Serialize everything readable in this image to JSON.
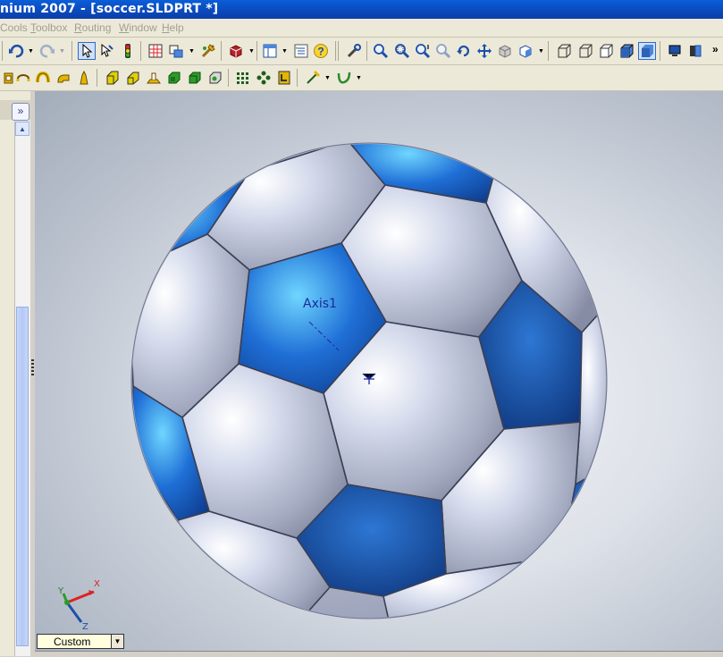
{
  "window": {
    "title": "nium 2007 - [soccer.SLDPRT *]"
  },
  "menu": {
    "items": [
      "Cools",
      "Toolbox",
      "Routing",
      "Window",
      "Help"
    ]
  },
  "toolbar_top": {
    "icons": [
      "undo-icon",
      "redo-icon",
      "select-icon",
      "smart-select-icon",
      "traffic-light-icon",
      "grid-icon",
      "options-icon",
      "rebuild-icon",
      "3d-box-icon",
      "view-layout-icon",
      "list-icon",
      "help-icon",
      "tool-icon",
      "zoom-fit-icon",
      "zoom-area-icon",
      "zoom-in-out-icon",
      "zoom-select-icon",
      "rotate-icon",
      "pan-icon",
      "view-orientation-icon",
      "standard-views-icon",
      "wireframe-icon",
      "hidden-lines-icon",
      "hidden-removed-icon",
      "shaded-edges-icon",
      "shaded-icon",
      "perspective-icon",
      "section-icon"
    ],
    "overflow": "»"
  },
  "toolbar_features": {
    "icons": [
      "extrude-icon",
      "revolve-icon",
      "sweep-icon",
      "loft-icon",
      "boss-icon",
      "fillet-icon",
      "chamfer-icon",
      "shell-icon",
      "draft-icon",
      "rib-icon",
      "pattern-icon",
      "mirror-icon",
      "hole-icon",
      "reference-icon",
      "curves-icon"
    ]
  },
  "feature_tree": {
    "expand_label": "»"
  },
  "viewport": {
    "axis_label": "Axis1",
    "view_name": "Custom",
    "triad": {
      "x": "X",
      "y": "Y",
      "z": "Z"
    },
    "ball_colors": {
      "blue": "#1f6fd6",
      "white_panel": "#d9dff0",
      "seam": "#3a3f55"
    }
  }
}
